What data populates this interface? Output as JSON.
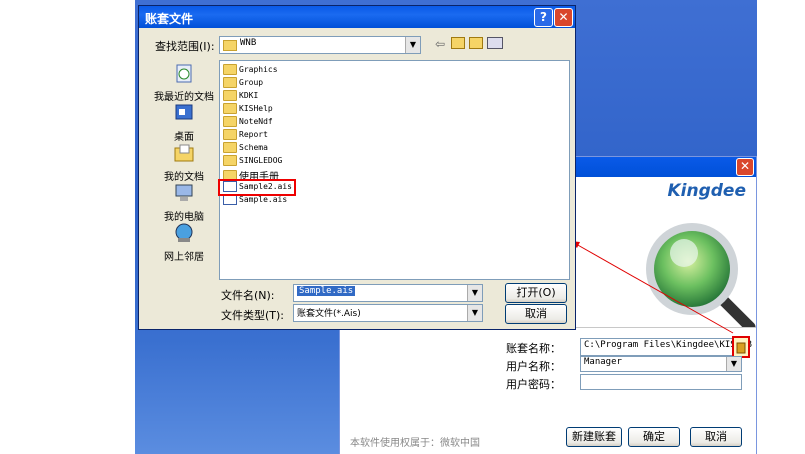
{
  "file_dialog": {
    "title": "账套文件",
    "lookin_label": "查找范围(I):",
    "lookin_value": "WNB",
    "places": [
      {
        "label": "我最近的文档",
        "icon": "recent-documents-icon"
      },
      {
        "label": "桌面",
        "icon": "desktop-icon"
      },
      {
        "label": "我的文档",
        "icon": "my-documents-icon"
      },
      {
        "label": "我的电脑",
        "icon": "my-computer-icon"
      },
      {
        "label": "网上邻居",
        "icon": "network-places-icon"
      }
    ],
    "files": [
      {
        "name": "Graphics",
        "type": "folder"
      },
      {
        "name": "Group",
        "type": "folder"
      },
      {
        "name": "KDKI",
        "type": "folder"
      },
      {
        "name": "KISHelp",
        "type": "folder"
      },
      {
        "name": "NoteNdf",
        "type": "folder"
      },
      {
        "name": "Report",
        "type": "folder"
      },
      {
        "name": "Schema",
        "type": "folder"
      },
      {
        "name": "SINGLEDOG",
        "type": "folder"
      },
      {
        "name": "使用手册",
        "type": "folder"
      },
      {
        "name": "Sample2.ais",
        "type": "file"
      },
      {
        "name": "Sample.ais",
        "type": "file"
      }
    ],
    "filename_label": "文件名(N):",
    "filename_value": "Sample.ais",
    "filetype_label": "文件类型(T):",
    "filetype_value": "账套文件(*.Ais)",
    "open_label": "打开(O)",
    "cancel_label": "取消"
  },
  "login_dialog": {
    "brand": "Kingdee",
    "account_label": "账套名称：",
    "account_value": "C:\\Program Files\\Kingdee\\KIS\\WB",
    "user_label": "用户名称：",
    "user_value": "Manager",
    "password_label": "用户密码：",
    "password_value": "",
    "license_text": "本软件使用权属于：微软中国",
    "new_account_label": "新建账套",
    "ok_label": "确定",
    "cancel_label": "取消"
  },
  "colors": {
    "title_blue": "#0a5ae8",
    "highlight_red": "#e00000",
    "brand_blue": "#1f5fb0",
    "selection_blue": "#316ac5"
  }
}
